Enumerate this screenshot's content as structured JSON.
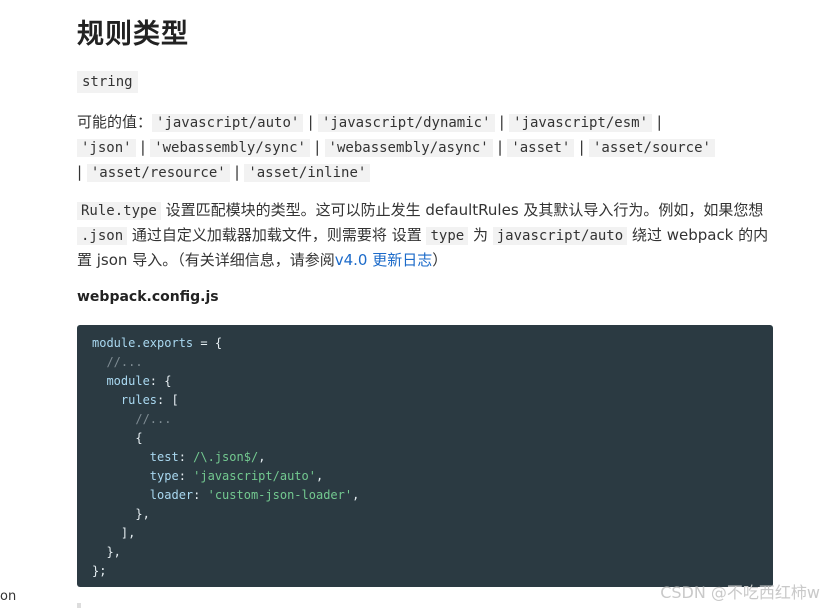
{
  "title": "规则类型",
  "type_chip": "string",
  "values": {
    "prefix": "可能的值：",
    "line1": [
      "'javascript/auto'",
      "'javascript/dynamic'",
      "'javascript/esm'"
    ],
    "line2": [
      "'json'",
      "'webassembly/sync'",
      "'webassembly/async'",
      "'asset'",
      "'asset/source'"
    ],
    "line3": [
      "'asset/resource'",
      "'asset/inline'"
    ],
    "sep": "|"
  },
  "desc": {
    "code_rule_type": "Rule.type",
    "t1": " 设置匹配模块的类型。这可以防止发生 defaultRules 及其默认导入行为。例如，如果您想 ",
    "code_json": ".json",
    "t2": " 通过自定义加载器加载文件，则需要将 设置 ",
    "code_type": "type",
    "t3": " 为 ",
    "code_js_auto": "javascript/auto",
    "t4": " 绕过 webpack 的内置 json 导入。（有关详细信息，请参阅",
    "link": "v4.0 更新日志",
    "t5": "）"
  },
  "config_label": "webpack.config.js",
  "code": {
    "l1_a": "module.exports",
    "l1_b": " = {",
    "l2": "  //...",
    "l3_a": "  module",
    "l3_b": ": {",
    "l4_a": "    rules",
    "l4_b": ": [",
    "l5": "      //...",
    "l6": "      {",
    "l7_a": "        test",
    "l7_b": ": ",
    "l7_c": "/\\.json$/",
    "l7_d": ",",
    "l8_a": "        type",
    "l8_b": ": ",
    "l8_c": "'javascript/auto'",
    "l8_d": ",",
    "l9_a": "        loader",
    "l9_b": ": ",
    "l9_c": "'custom-json-loader'",
    "l9_d": ",",
    "l10": "      },",
    "l11": "    ],",
    "l12": "  },",
    "l13": "};"
  },
  "watermark": "CSDN @不吃西红柿w",
  "left_cut": "on"
}
